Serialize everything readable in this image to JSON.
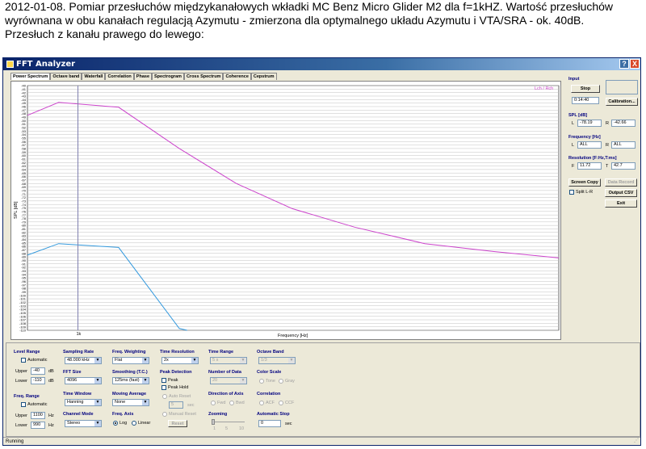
{
  "intro": {
    "line1": "2012-01-08. Pomiar przesłuchów międzykanałowych wkładki MC Benz Micro Glider M2 dla f=1kHZ. Wartość przesłuchów",
    "line2": "wyrównana w obu kanałach regulacją Azymutu - zmierzona dla optymalnego układu Azymutu i VTA/SRA - ok. 40dB.",
    "line3": "Przesłuch z kanału prawego do lewego:"
  },
  "window": {
    "title": "FFT Analyzer",
    "help": "?",
    "close": "X"
  },
  "tabs": [
    "Power Spectrum",
    "Octave band",
    "Waterfall",
    "Correlation",
    "Phase",
    "Spectrogram",
    "Cross Spectrum",
    "Coherence",
    "Cepstrum"
  ],
  "plot": {
    "legend": "Lch / Rch",
    "y_axis_label": "SPL [dB]",
    "x_axis_label": "Frequency [Hz]",
    "x_tick": "1k"
  },
  "chart_data": {
    "type": "line",
    "title": "",
    "xlabel": "Frequency [Hz]",
    "ylabel": "SPL [dB]",
    "xscale": "log",
    "ylim": [
      -110,
      -40
    ],
    "yticks": [
      -40,
      -41,
      -42,
      -43,
      -44,
      -45,
      -46,
      -47,
      -48,
      -49,
      -50,
      -51,
      -52,
      -53,
      -54,
      -55,
      -56,
      -57,
      -58,
      -59,
      -60,
      -61,
      -62,
      -63,
      -64,
      -65,
      -66,
      -67,
      -68,
      -69,
      -70,
      -71,
      -72,
      -73,
      -74,
      -75,
      -76,
      -77,
      -78,
      -79,
      -80,
      -81,
      -82,
      -83,
      -84,
      -85,
      -86,
      -87,
      -88,
      -89,
      -90,
      -91,
      -92,
      -93,
      -94,
      -95,
      -96,
      -97,
      -98,
      -99,
      -100,
      -101,
      -102,
      -103,
      -104,
      -105,
      -106,
      -107,
      -108,
      -109,
      -110
    ],
    "grid": true,
    "legend_position": "top-right",
    "series": [
      {
        "name": "Rch",
        "color": "#cc44cc",
        "x": [
          0,
          40,
          117,
          195,
          268,
          340,
          420,
          510,
          600,
          682
        ],
        "y": [
          -48.5,
          -44.8,
          -46.2,
          -58,
          -68,
          -75.2,
          -80.5,
          -85.2,
          -87.5,
          -89.3
        ]
      },
      {
        "name": "Lch",
        "color": "#3399dd",
        "x": [
          0,
          40,
          117,
          195,
          205
        ],
        "y": [
          -88.5,
          -85.2,
          -86.3,
          -109.5,
          -110
        ]
      }
    ]
  },
  "input": {
    "header": "Input",
    "stop_label": "Stop",
    "time": "0:14:40",
    "calibration_label": "Calibration..."
  },
  "spl": {
    "header": "SPL [dB]",
    "l_label": "L",
    "l_value": "-78.19",
    "r_label": "R",
    "r_value": "-42.66"
  },
  "frequency": {
    "header": "Frequency [Hz]",
    "l_label": "L",
    "l_value": "ALL",
    "r_label": "R",
    "r_value": "ALL"
  },
  "resolution": {
    "header": "Resolution [F:Hz,T:ms]",
    "f_label": "F",
    "f_value": "11.72",
    "t_label": "T",
    "t_value": "42.7"
  },
  "actions": {
    "screen_copy": "Screen Copy",
    "data_record": "Data Record",
    "split_lr": "Split L-R",
    "output_csv": "Output CSV",
    "exit": "Exit"
  },
  "level_range": {
    "header": "Level Range",
    "automatic": "Automatic",
    "upper_label": "Upper",
    "upper_value": "-40",
    "upper_unit": "dB",
    "lower_label": "Lower",
    "lower_value": "-110",
    "lower_unit": "dB"
  },
  "freq_range": {
    "header": "Freq. Range",
    "automatic": "Automatic",
    "upper_label": "Upper",
    "upper_value": "1100",
    "upper_unit": "Hz",
    "lower_label": "Lower",
    "lower_value": "990",
    "lower_unit": "Hz"
  },
  "sampling_rate": {
    "header": "Sampling Rate",
    "value": "48.000 kHz"
  },
  "fft_size": {
    "header": "FFT Size",
    "value": "4096"
  },
  "time_window": {
    "header": "Time Window",
    "value": "Hanning"
  },
  "channel_mode": {
    "header": "Channel Mode",
    "value": "Stereo"
  },
  "freq_weighting": {
    "header": "Freq. Weighting",
    "value": "Flat"
  },
  "smoothing": {
    "header": "Smoothing (T.C.)",
    "value": "125ms (fast)"
  },
  "moving_average": {
    "header": "Moving Average",
    "value": "None"
  },
  "freq_axis": {
    "header": "Freq. Axis",
    "log": "Log",
    "linear": "Linear"
  },
  "time_resolution": {
    "header": "Time Resolution",
    "value": "2x"
  },
  "peak_detection": {
    "header": "Peak Detection",
    "peak": "Peak",
    "peak_hold": "Peak Hold",
    "auto_reset": "Auto Reset",
    "auto_value": "5",
    "auto_unit": "sec",
    "manual_reset": "Manual Reset",
    "reset": "Reset"
  },
  "time_range": {
    "header": "Time Range",
    "value": "5 s"
  },
  "number_of_data": {
    "header": "Number of Data",
    "value": "20"
  },
  "direction_of_axis": {
    "header": "Direction of Axis",
    "fwd": "Fwd",
    "bwd": "Bwd"
  },
  "zooming": {
    "header": "Zooming",
    "ticks": [
      "1",
      "5",
      "10"
    ]
  },
  "octave_band": {
    "header": "Octave Band",
    "value": "1/3"
  },
  "color_scale": {
    "header": "Color Scale",
    "tone": "Tone",
    "gray": "Gray"
  },
  "correlation": {
    "header": "Correlation",
    "acf": "ACF",
    "ccf": "CCF"
  },
  "automatic_stop": {
    "header": "Automatic Stop",
    "value": "0",
    "unit": "sec"
  },
  "status": "Running"
}
